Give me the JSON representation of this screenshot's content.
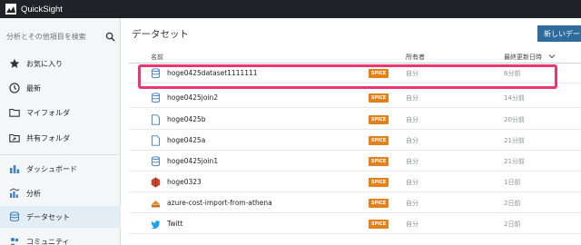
{
  "app": {
    "title": "QuickSight",
    "accent": "#2d6c9c",
    "badge_color": "#e3821a"
  },
  "sidebar": {
    "search": {
      "placeholder": "分析とその他項目を検索",
      "icon": "search-icon"
    },
    "items": [
      {
        "label": "お気に入り",
        "icon": "star-icon"
      },
      {
        "label": "最新",
        "icon": "clock-icon"
      },
      {
        "label": "マイフォルダ",
        "icon": "folder-icon"
      },
      {
        "label": "共有フォルダ",
        "icon": "shared-folder-icon"
      },
      {
        "label": "ダッシュボード",
        "icon": "dashboard-icon"
      },
      {
        "label": "分析",
        "icon": "analysis-icon"
      },
      {
        "label": "データセット",
        "icon": "dataset-icon",
        "active": true
      },
      {
        "label": "コミュニティ",
        "icon": "community-icon"
      }
    ]
  },
  "main": {
    "title": "データセット",
    "new_button": "新しいデータセット",
    "columns": {
      "name": "名前",
      "owner": "所有者",
      "updated": "最終更新日時"
    },
    "rows": [
      {
        "name": "hoge0425dataset1111111",
        "badge": "SPICE",
        "owner": "自分",
        "updated": "6分前",
        "icon": "dataset-icon"
      },
      {
        "name": "hoge0425join2",
        "badge": "SPICE",
        "owner": "自分",
        "updated": "14分前",
        "icon": "dataset-icon"
      },
      {
        "name": "hoge0425b",
        "badge": "SPICE",
        "owner": "自分",
        "updated": "20分前",
        "icon": "file-icon"
      },
      {
        "name": "hoge0425a",
        "badge": "SPICE",
        "owner": "自分",
        "updated": "21分前",
        "icon": "file-icon"
      },
      {
        "name": "hoge0425join1",
        "badge": "SPICE",
        "owner": "自分",
        "updated": "21分前",
        "icon": "dataset-icon"
      },
      {
        "name": "hoge0323",
        "badge": "SPICE",
        "owner": "自分",
        "updated": "1日前",
        "icon": "aws-icon"
      },
      {
        "name": "azure-cost-import-from-athena",
        "badge": "SPICE",
        "owner": "自分",
        "updated": "2日前",
        "icon": "athena-icon"
      },
      {
        "name": "Twitt",
        "badge": "SPICE",
        "owner": "自分",
        "updated": "2日前",
        "icon": "twitter-icon"
      }
    ]
  }
}
